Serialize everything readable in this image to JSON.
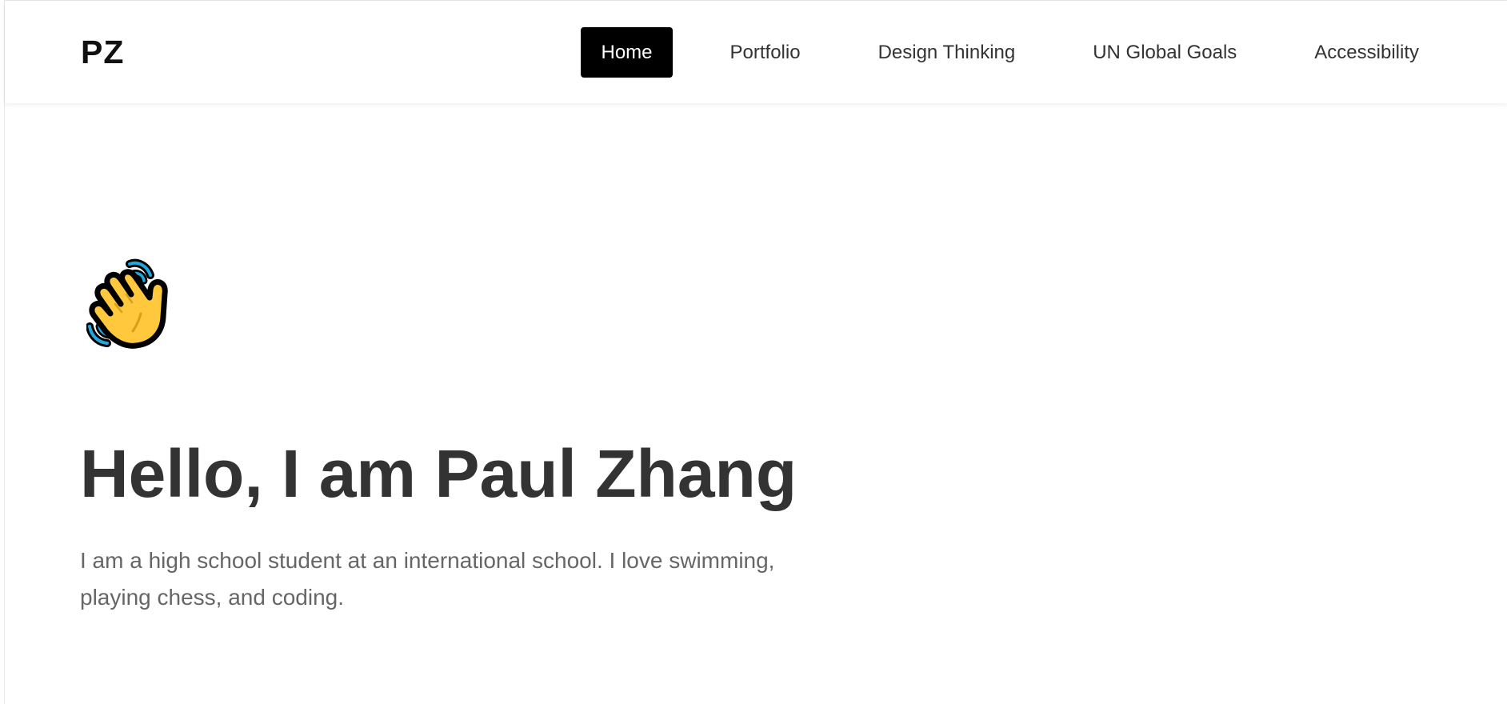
{
  "logo": "PZ",
  "nav": {
    "items": [
      {
        "label": "Home",
        "active": true
      },
      {
        "label": "Portfolio",
        "active": false
      },
      {
        "label": "Design Thinking",
        "active": false
      },
      {
        "label": "UN Global Goals",
        "active": false
      },
      {
        "label": "Accessibility",
        "active": false
      }
    ]
  },
  "hero": {
    "icon": "waving-hand-icon",
    "title": "Hello, I am Paul Zhang",
    "text": "I am a high school student at an international school. I love swimming, playing chess, and coding."
  },
  "colors": {
    "active_nav_bg": "#000000",
    "active_nav_text": "#ffffff",
    "heading": "#333333",
    "body_text": "#666666",
    "emoji_yellow": "#FFC83D",
    "motion_lines": "#1EA7E1"
  }
}
